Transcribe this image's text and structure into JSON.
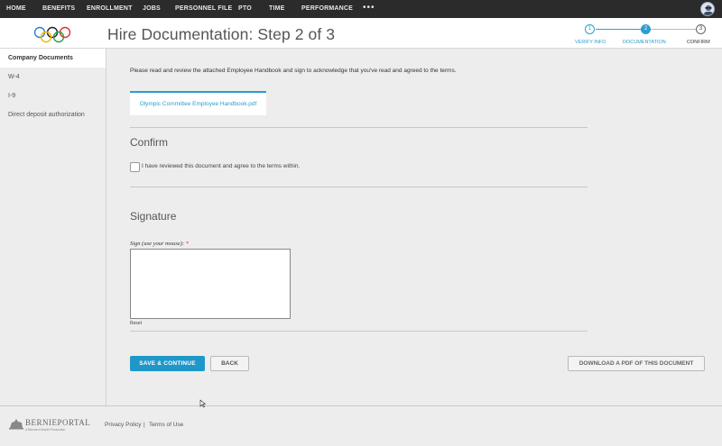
{
  "nav": {
    "items": [
      "HOME",
      "BENEFITS",
      "ENROLLMENT",
      "JOBS",
      "PERSONNEL FILE",
      "PTO",
      "TIME",
      "PERFORMANCE"
    ],
    "more": "•••"
  },
  "header": {
    "title": "Hire Documentation: Step 2 of 3",
    "steps": [
      {
        "num": "1",
        "label": "VERIFY INFO"
      },
      {
        "num": "2",
        "label": "DOCUMENTATION"
      },
      {
        "num": "3",
        "label": "CONFIRM"
      }
    ],
    "accent": "#2b9ed1"
  },
  "sidebar": {
    "items": [
      {
        "label": "Company Documents"
      },
      {
        "label": "W-4"
      },
      {
        "label": "I-9"
      },
      {
        "label": "Direct deposit authorization"
      }
    ]
  },
  "main": {
    "intro": "Please read and review the attached Employee Handbook and sign to acknowledge that you've read and agreed to the terms.",
    "document_link": "Olympic Committee Employee Handbook.pdf",
    "confirm_heading": "Confirm",
    "checkbox_label": "I have reviewed this document and agree to the terms within.",
    "signature_heading": "Signature",
    "sign_label": "Sign (use your mouse):",
    "required_mark": "*",
    "reset_label": "Reset",
    "save_label": "SAVE & CONTINUE",
    "back_label": "BACK",
    "pdf_label": "DOWNLOAD A PDF OF THIS DOCUMENT"
  },
  "footer": {
    "brand": "BERNIEPORTAL",
    "brand_sub": "A Bernard Health Production",
    "privacy": "Privacy Policy",
    "separator": "|",
    "terms": "Terms of Use"
  },
  "colors": {
    "primary_button": "#1f97c9",
    "link": "#2b9ed1",
    "nav_bg": "#2b2b2b"
  }
}
